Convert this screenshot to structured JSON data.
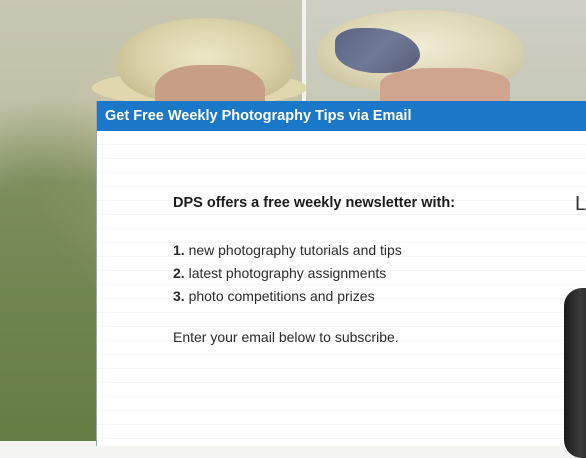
{
  "modal": {
    "title": "Get Free Weekly Photography Tips via Email",
    "lead": "DPS offers a free weekly newsletter with:",
    "benefits": [
      {
        "num": "1.",
        "text": " new photography tutorials and tips"
      },
      {
        "num": "2.",
        "text": " latest photography assignments"
      },
      {
        "num": "3.",
        "text": " photo competitions and prizes"
      }
    ],
    "cta": "Enter your email below to subscribe.",
    "right_letter": "L"
  },
  "colors": {
    "header_blue": "#1b78c8"
  }
}
